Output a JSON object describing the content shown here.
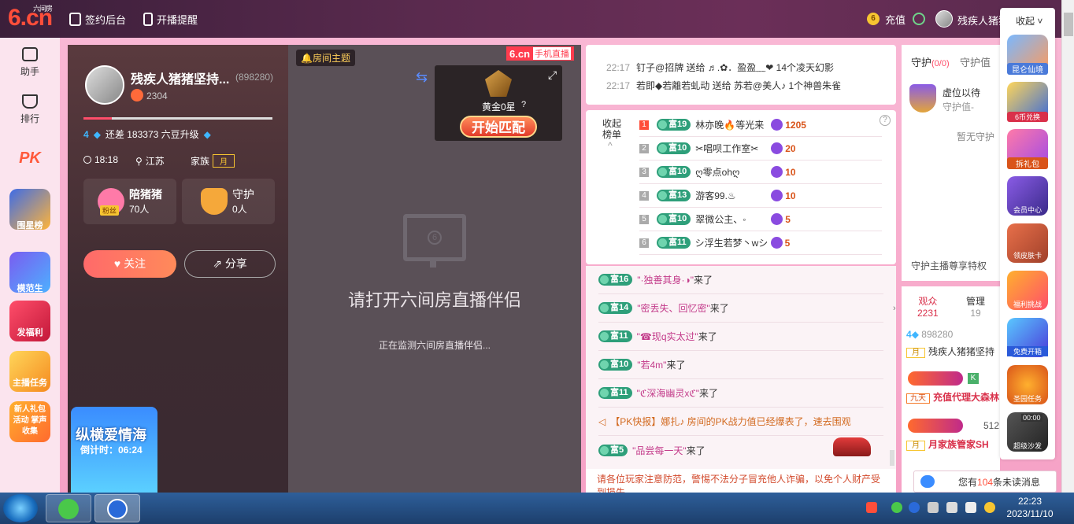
{
  "topbar": {
    "logo": "6.cn",
    "logo_sub": "六间房",
    "sign_backend": "签约后台",
    "live_reminder": "开播提醒",
    "recharge": "充值",
    "coin_glyph": "6",
    "username": "残疾人猪猪坚",
    "collapse": "收起"
  },
  "leftnav": {
    "items": [
      {
        "label": "助手"
      },
      {
        "label": "排行"
      },
      {
        "label": "PK"
      }
    ],
    "promos": [
      "围星榜",
      "模范生",
      "发福利",
      "主播任务",
      "新人礼包 活动 掌声收集"
    ]
  },
  "anchor": {
    "name": "残疾人猪猪坚持...",
    "room_id": "(898280)",
    "heat": "2304",
    "upgrade_prefix": "4",
    "upgrade_text": "还差 183373 六豆升级",
    "time": "18:18",
    "location": "江苏",
    "family_label": "家族",
    "family_badge": "月",
    "fans_title": "陪猪猪",
    "fans_count": "70人",
    "fans_badge": "粉丝",
    "guard_title": "守护",
    "guard_count": "0人",
    "follow": "关注",
    "share": "分享",
    "event_title": "纵横爱情海",
    "event_countdown": "倒计时：06:24"
  },
  "video": {
    "room_topic": "房间主题",
    "mobile_logo": "6.cn",
    "mobile_tag": "手机直播",
    "match_rank": "黄金0星",
    "match_help": "?",
    "match_button": "开始匹配",
    "monitor_digit": "6",
    "open_prompt": "请打开六间房直播伴侣",
    "monitoring": "正在监测六间房直播伴侣..."
  },
  "gifts": [
    {
      "time": "22:17",
      "text": "钉子@招牌 送给 ♬.✿．盈盈﹏❤ 14个凌天幻影"
    },
    {
      "time": "22:17",
      "text": "若即◆若離若虬动 送给 苏若@美人♪ 1个神兽朱雀"
    }
  ],
  "rank": {
    "toggle": "收起 榜单",
    "help": "?",
    "rows": [
      {
        "no": "1",
        "level": "富19",
        "name": "林亦晚🔥等光来",
        "score": "1205"
      },
      {
        "no": "2",
        "level": "富10",
        "name": "✂唱呗工作室✂",
        "score": "20"
      },
      {
        "no": "3",
        "level": "富10",
        "name": "ღ零点ohღ",
        "score": "10"
      },
      {
        "no": "4",
        "level": "富13",
        "name": "游客99.♨",
        "score": "10"
      },
      {
        "no": "5",
        "level": "富10",
        "name": "翠微公主、◦",
        "score": "5"
      },
      {
        "no": "6",
        "level": "富11",
        "name": "シ浮生若梦丶wシ",
        "score": "5"
      }
    ]
  },
  "chat": [
    {
      "level": "富16",
      "name": "\"·独善其身·◑\"",
      "suffix": "来了"
    },
    {
      "level": "富14",
      "name": "\"密丢失、回忆密\"",
      "suffix": "来了"
    },
    {
      "level": "富11",
      "name": "\"☎现q实太过\"",
      "suffix": "来了"
    },
    {
      "level": "富10",
      "name": "\"若4m\"",
      "suffix": "来了"
    },
    {
      "level": "富11",
      "name": "\"ℭ深海幽灵xℭ\"",
      "suffix": "来了"
    },
    {
      "level": "",
      "name": "【PK快报】娜扎♪ 房间的PK战力值已经爆表了，速去围观",
      "suffix": ""
    },
    {
      "level": "富5",
      "name": "\"品尝每一天\"",
      "suffix": "来了"
    }
  ],
  "notice": "请各位玩家注意防范，警惕不法分子冒充他人诈骗，以免个人财产受到损失",
  "guard": {
    "tab_guard": "守护",
    "tab_guard_count": "(0/0)",
    "tab_value": "守护值",
    "vacant": "虚位以待",
    "guard_value": "守护值-",
    "none": "暂无守护",
    "privilege": "守护主播尊享特权"
  },
  "audience": {
    "tab_audience": "观众",
    "audience_count": "2231",
    "tab_admin": "管理",
    "admin_count": "19",
    "users": [
      {
        "badge": "4",
        "id": "898280",
        "tag": "月",
        "name": "残疾人猪猪坚持"
      },
      {
        "badge": "K",
        "id": "",
        "tag": "九天",
        "name": "充值代理大森林"
      },
      {
        "badge": "",
        "id": "512",
        "tag": "月",
        "name": "月家族管家SH"
      }
    ]
  },
  "rightbar": [
    "昆仑仙境",
    "6币兑换",
    "拆礼包",
    "会员中心",
    "领皮肤卡",
    "福利挑战",
    "免费开箱",
    "圣园任务",
    "超级沙发"
  ],
  "rightbar_timer": "00:00",
  "unread": {
    "prefix": "您有",
    "count": "104",
    "suffix": "条未读消息"
  },
  "taskbar": {
    "time": "22:23",
    "date": "2023/11/10"
  },
  "colors": {
    "accent": "#ff4e3a",
    "pink_bg": "#f6a2c6",
    "rich_level": "#2e9f7a"
  }
}
